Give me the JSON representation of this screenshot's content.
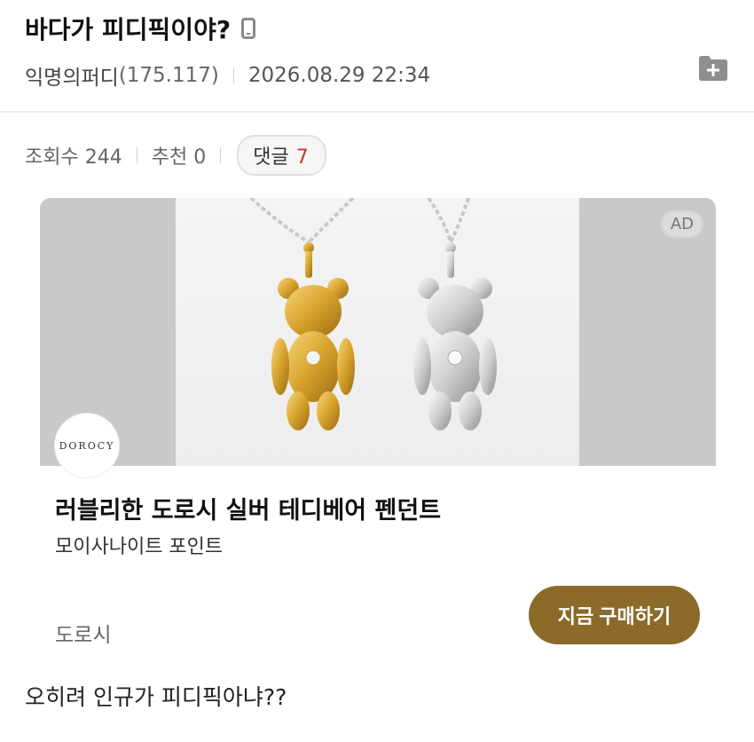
{
  "post": {
    "title": "바다가 피디픽이야?",
    "author": "익명의퍼디",
    "ip": "(175.117)",
    "datetime": "2026.08.29 22:34",
    "views_label": "조회수 244",
    "recommend_label": "추천 0",
    "comments_label": "댓글",
    "comments_count": "7",
    "body": "오히려 인규가 피디픽아냐??"
  },
  "ad": {
    "badge": "AD",
    "brand_logo_text": "DOROCY",
    "title": "러블리한 도로시 실버 테디베어 펜던트",
    "subtitle": "모이사나이트 포인트",
    "advertiser": "도로시",
    "cta_label": "지금 구매하기",
    "accent_color": "#8b6a2a"
  },
  "icons": {
    "device": "mobile-phone-icon",
    "folder_add": "folder-plus-icon"
  }
}
